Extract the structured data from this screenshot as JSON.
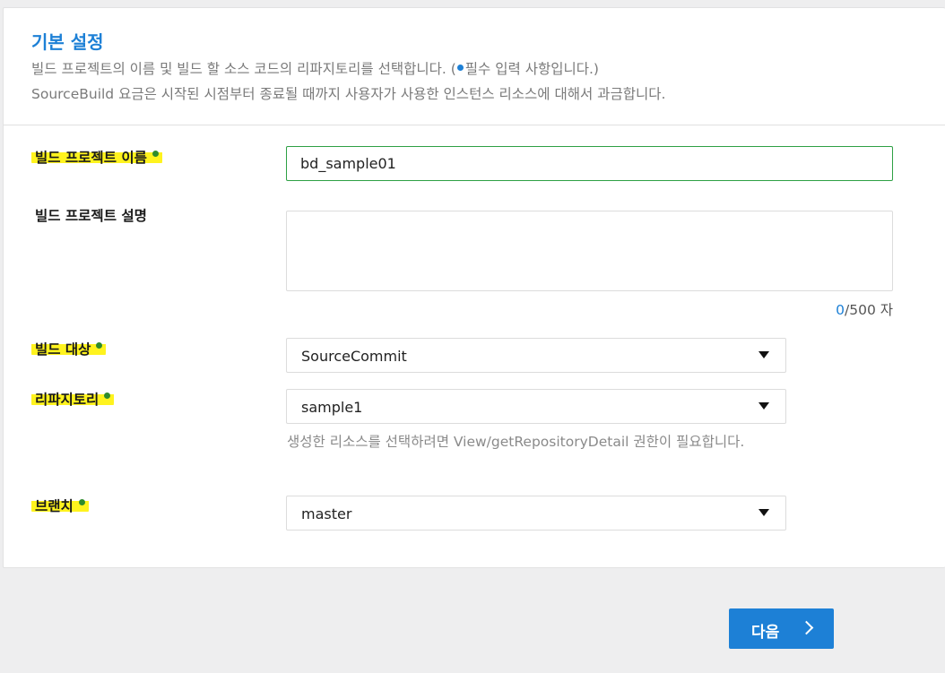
{
  "header": {
    "title": "기본 설정",
    "desc_line1_a": "빌드 프로젝트의 이름 및 빌드 할 소스 코드의 리파지토리를 선택합니다. (",
    "desc_line1_b": "필수 입력 사항입니다.)",
    "desc_line2": "SourceBuild 요금은 시작된 시점부터 종료될 때까지 사용자가 사용한 인스턴스 리소스에 대해서 과금합니다."
  },
  "form": {
    "project_name": {
      "label": "빌드 프로젝트 이름",
      "value": "bd_sample01"
    },
    "project_desc": {
      "label": "빌드 프로젝트 설명",
      "value": "",
      "count": "0",
      "max_text": "/500 자"
    },
    "build_target": {
      "label": "빌드 대상",
      "selected": "SourceCommit"
    },
    "repository": {
      "label": "리파지토리",
      "selected": "sample1",
      "hint": "생성한 리소스를 선택하려면 View/getRepositoryDetail 권한이 필요합니다."
    },
    "branch": {
      "label": "브랜치",
      "selected": "master"
    }
  },
  "footer": {
    "next_label": "다음"
  },
  "colors": {
    "accent": "#1d80d6",
    "required_dot_label": "#2e8b2e",
    "highlight": "#fff31e",
    "active_border": "#2ea044"
  }
}
